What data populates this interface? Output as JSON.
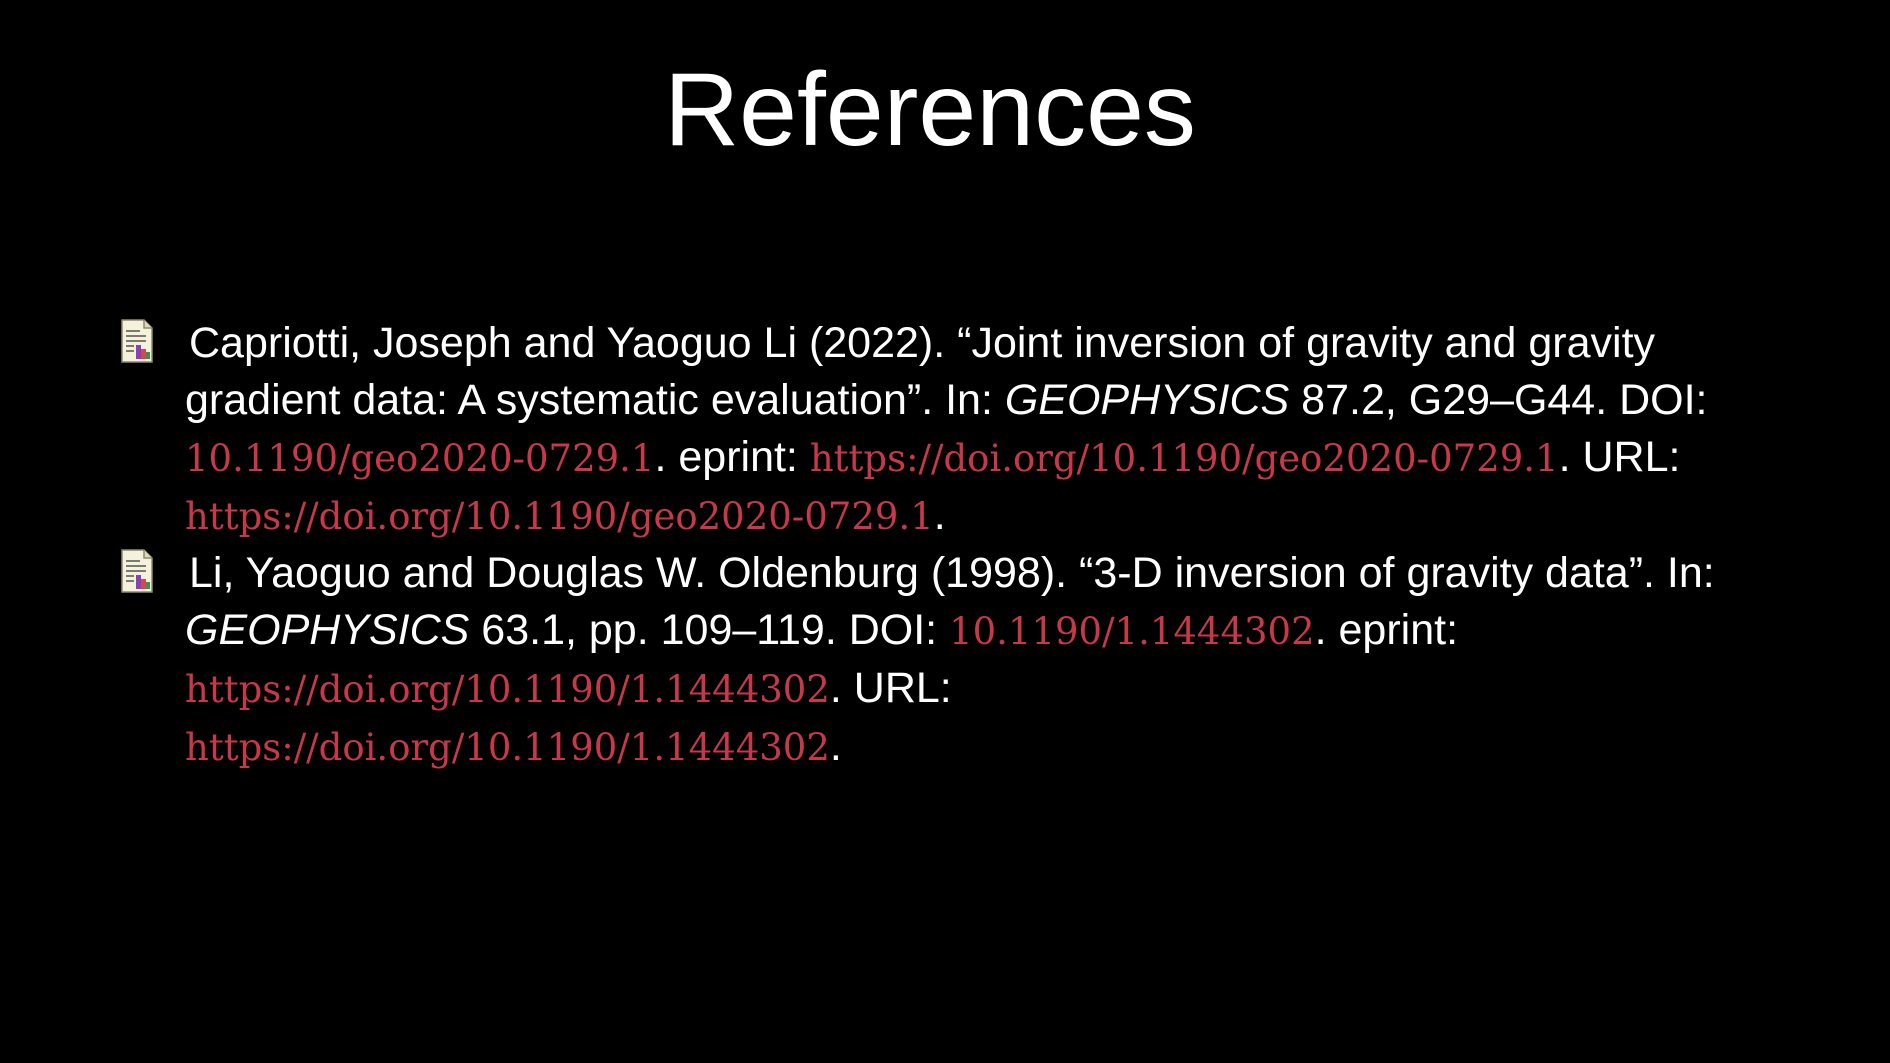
{
  "title": "References",
  "references": [
    {
      "lead": "Capriotti, Joseph and Yaoguo Li (2022). “Joint inversion of gravity and gravity gradient data: A systematic evaluation”. In: ",
      "journal": "GEOPHYSICS",
      "after_journal": " 87.2, G29–G44. DOI: ",
      "doi": "10.1190/geo2020-0729.1",
      "after_doi": ". eprint: ",
      "eprint": "https://doi.org/10.1190/geo2020-0729.1",
      "after_eprint": ". URL: ",
      "url": "https://doi.org/10.1190/geo2020-0729.1",
      "end": "."
    },
    {
      "lead": "Li, Yaoguo and Douglas W. Oldenburg (1998). “3-D inversion of gravity data”. In: ",
      "journal": "GEOPHYSICS",
      "after_journal": " 63.1, pp. 109–119. DOI: ",
      "doi": "10.1190/1.1444302",
      "after_doi": ". eprint: ",
      "eprint": "https://doi.org/10.1190/1.1444302",
      "after_eprint": ". URL: ",
      "url": "https://doi.org/10.1190/1.1444302",
      "end": "."
    }
  ],
  "icon": "bibliography-article-icon",
  "colors": {
    "background": "#000000",
    "text": "#ffffff",
    "link": "#c6384a"
  }
}
